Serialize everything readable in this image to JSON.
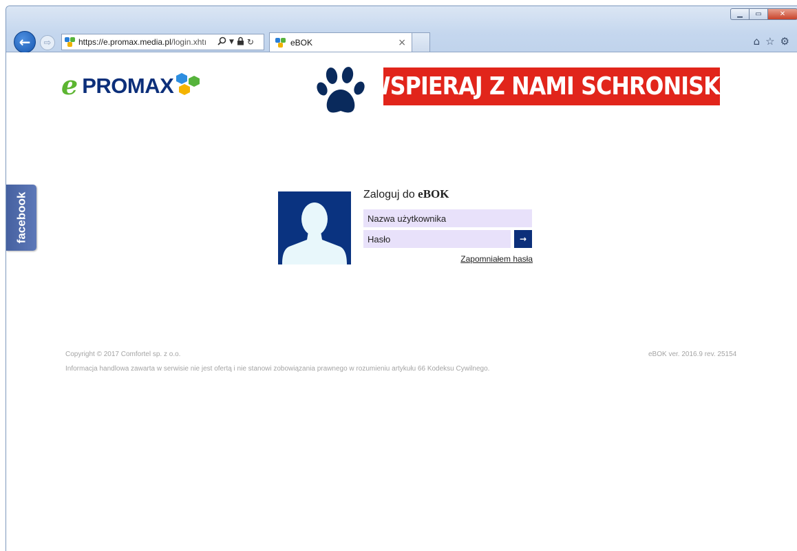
{
  "browser": {
    "url_host": "https://e.promax.media.pl",
    "url_path": "/login.xhtı",
    "tab_title": "eBOK",
    "tab_close_glyph": "×",
    "icons": [
      "back-arrow-icon",
      "forward-arrow-icon",
      "search-icon",
      "dropdown-icon",
      "lock-icon",
      "refresh-icon",
      "home-icon",
      "star-icon",
      "gear-icon"
    ]
  },
  "header": {
    "logo_e": "e",
    "logo_word": "PROMAX",
    "banner_text": "WSPIERAJ Z NAMI SCHRONISKO",
    "colors": {
      "banner": "#e1251b",
      "brand_navy": "#0c2f7a",
      "brand_green": "#5cb531"
    }
  },
  "side": {
    "facebook_label": "facebook"
  },
  "login": {
    "title_prefix": "Zaloguj do",
    "title_bold": "eBOK",
    "username_placeholder": "Nazwa użytkownika",
    "password_placeholder": "Hasło",
    "submit_glyph": "→",
    "forgot_link": "Zapomniałem hasła",
    "field_color": "#e8e1fa"
  },
  "footer": {
    "copyright": "Copyright © 2017 Comfortel sp. z o.o.",
    "disclaimer": "Informacja handlowa zawarta w serwisie nie jest ofertą i nie stanowi zobowiązania prawnego w rozumieniu artykułu 66 Kodeksu Cywilnego.",
    "version": "eBOK ver. 2016.9 rev. 25154"
  }
}
